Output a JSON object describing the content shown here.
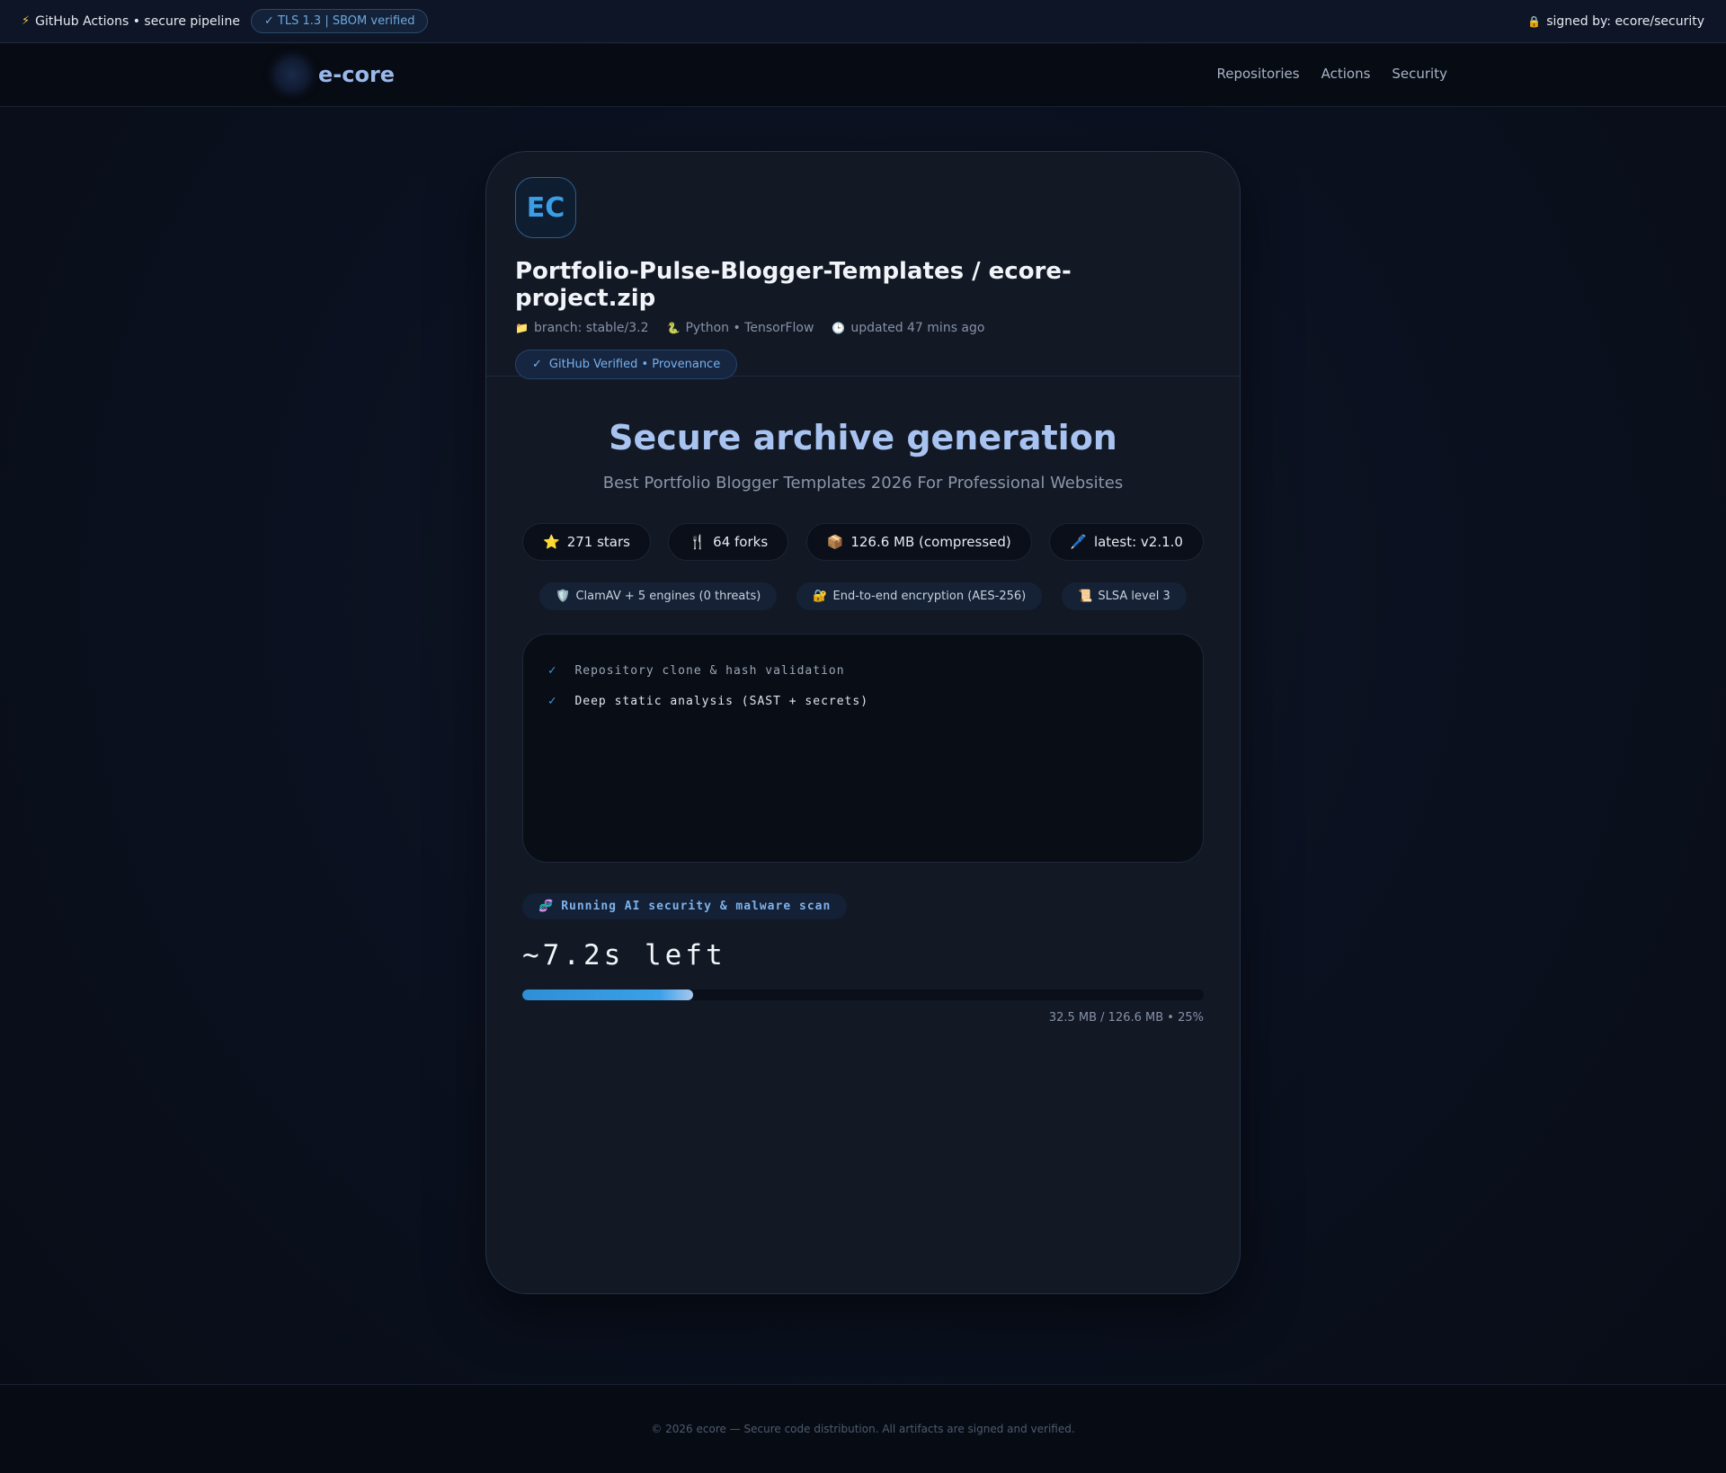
{
  "topbar": {
    "pipeline_label": "GitHub Actions • secure pipeline",
    "tls_label": "✓ TLS 1.3 | SBOM verified",
    "signed_label": "signed by: ecore/security"
  },
  "nav": {
    "brand": "e-core",
    "links": [
      "Repositories",
      "Actions",
      "Security"
    ]
  },
  "repo": {
    "avatar_initials": "EC",
    "title": "Portfolio-Pulse-Blogger-Templates / ecore-project.zip",
    "branch": "branch: stable/3.2",
    "stack": "Python • TensorFlow",
    "updated": "updated 47 mins ago",
    "verified": "GitHub Verified • Provenance"
  },
  "main": {
    "headline": "Secure archive generation",
    "subline": "Best Portfolio Blogger Templates 2026 For Professional Websites",
    "stats": {
      "stars": "271 stars",
      "forks": "64 forks",
      "size": "126.6 MB (compressed)",
      "latest": "latest: v2.1.0"
    },
    "badges": {
      "av": "ClamAV + 5 engines (0 threats)",
      "enc": "End-to-end encryption (AES-256)",
      "slsa": "SLSA level 3"
    },
    "log": [
      "Repository clone & hash validation",
      "Deep static analysis (SAST + secrets)"
    ],
    "scan_status": "Running AI security & malware scan",
    "eta": "~7.2s left",
    "progress_fraction": 0.25,
    "progress_text": "32.5 MB / 126.6 MB • 25%"
  },
  "icons": {
    "bolt": "bolt-icon",
    "lock": "lock-icon",
    "folder": "folder-icon",
    "snake": "python-icon",
    "clock": "clock-icon",
    "star": "star-icon",
    "fork": "fork-icon",
    "package": "package-icon",
    "pen": "pen-icon",
    "shield": "shield-icon",
    "key-lock": "encryption-icon",
    "scroll": "scroll-icon",
    "dna": "dna-icon",
    "check": "check-icon"
  },
  "colors": {
    "accent": "#3a9ee6",
    "headline": "#a8c3f0",
    "background": "#0b1120"
  },
  "footer": {
    "text": "© 2026 ecore — Secure code distribution. All artifacts are signed and verified."
  }
}
